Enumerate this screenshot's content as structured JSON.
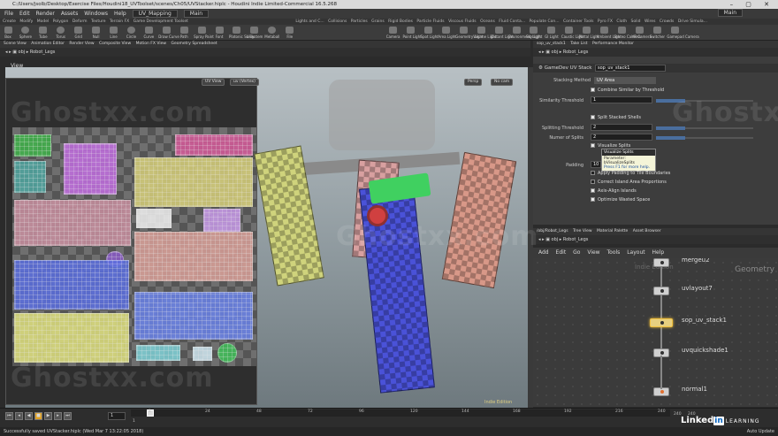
{
  "window": {
    "title": "C:/Users/jsolb/Desktop/Exercise Files/Houdini18_UVToolset/scenes/Ch05/UVStacker.hiplc - Houdini Indie Limited-Commercial 16.5.268"
  },
  "menubar": {
    "items": [
      "File",
      "Edit",
      "Render",
      "Assets",
      "Windows",
      "Help"
    ],
    "desktop": "UV_Mapping",
    "main": "Main",
    "main_right": "Main"
  },
  "shelf": {
    "tabs_left": [
      "Create",
      "Modify",
      "Model",
      "Polygon",
      "Deform",
      "Texture",
      "Terrain FX",
      "Game Development Toolset"
    ],
    "tabs_right": [
      "Lights and C...",
      "Collisions",
      "Particles",
      "Grains",
      "Rigid Bodies",
      "Particle Fluids",
      "Viscous Fluids",
      "Oceans",
      "Fluid Conta...",
      "Populate Con...",
      "Container Tools",
      "Pyro FX",
      "Cloth",
      "Solid",
      "Wires",
      "Crowds",
      "Drive Simula..."
    ],
    "tools_left": [
      "Box",
      "Sphere",
      "Tube",
      "Torus",
      "Grid",
      "Null",
      "Line",
      "Circle",
      "Curve",
      "Draw Curve",
      "Path",
      "Spray Paint",
      "Font",
      "Platonic Solids",
      "L-System",
      "Metaball",
      "File"
    ],
    "tools_right": [
      "Camera",
      "Point Light",
      "Spot Light",
      "Area Light",
      "Geometry Light",
      "Volume Light",
      "Distant Light",
      "Environment Light",
      "Sky Light",
      "GI Light",
      "Caustic Light",
      "Portal Light",
      "Ambient Light",
      "Stereo Camera",
      "VR Camera",
      "Switcher",
      "Gamepad Camera"
    ]
  },
  "left_pane": {
    "tabs": [
      "Scene View",
      "Animation Editor",
      "Render View",
      "Composite View",
      "Motion FX View",
      "Geometry Spreadsheet"
    ],
    "path_obj": "obj",
    "path_node": "Robot_Legs",
    "view_label": "View",
    "uv_view_btn": "UV View",
    "uv_vertex_btn": "uv (Vertex)",
    "persp_btn": "Persp",
    "cam_btn": "No cam",
    "indie_label": "Indie Edition"
  },
  "param_pane": {
    "tabs": [
      "sop_uv_stack1",
      "Take List",
      "Performance Monitor"
    ],
    "path_obj": "obj",
    "path_node": "Robot_Legs",
    "node_type": "GameDev UV Stack",
    "node_name": "sop_uv_stack1",
    "stacking_method_label": "Stacking Method",
    "stacking_method_value": "UV Area",
    "combine_similar": "Combine Similar by Threshold",
    "similarity_label": "Similarity Threshold",
    "similarity_value": "1",
    "split_stacked": "Split Stacked Shells",
    "splitting_label": "Splitting Threshold",
    "splitting_value": "2",
    "num_splits_label": "Numer of Splits",
    "num_splits_value": "2",
    "visualize": "Visualize Splits",
    "padding_label": "Padding",
    "padding_value": "10",
    "apply_padding": "Apply Padding to Tile Boundaries",
    "correct_island": "Correct Island Area Proportions",
    "axis_align": "Axis-Align Islands",
    "optimize": "Optimize Wasted Space",
    "tooltip": {
      "title": "Visualize Splits",
      "param": "Parameter: bVisualizeSplits",
      "help": "Press F1 for more help."
    }
  },
  "network_pane": {
    "tabs": [
      "/obj/Robot_Legs",
      "Tree View",
      "Material Palette",
      "Asset Browser"
    ],
    "path_obj": "obj",
    "path_node": "Robot_Legs",
    "menu": [
      "Add",
      "Edit",
      "Go",
      "View",
      "Tools",
      "Layout",
      "Help"
    ],
    "context_label": "Geometry",
    "indie_label": "Indie Edition",
    "nodes": [
      {
        "name": "mergeu2"
      },
      {
        "name": "uvlayout7"
      },
      {
        "name": "sop_uv_stack1"
      },
      {
        "name": "uvquickshade1"
      },
      {
        "name": "normal1"
      }
    ]
  },
  "timeline": {
    "current_frame": "1",
    "start": "1",
    "ticks": [
      "1",
      "24",
      "48",
      "72",
      "96",
      "120",
      "144",
      "168",
      "192",
      "216",
      "240"
    ],
    "end_a": "240",
    "end_b": "240"
  },
  "status": {
    "message": "Successfully saved UVStacker.hiplc (Wed Mar 7 13:22:05 2018)",
    "auto_update": "Auto Update"
  },
  "branding": {
    "linked": "Linked",
    "in": "in",
    "learning": "LEARNING"
  },
  "watermark": "Ghostxx.com"
}
